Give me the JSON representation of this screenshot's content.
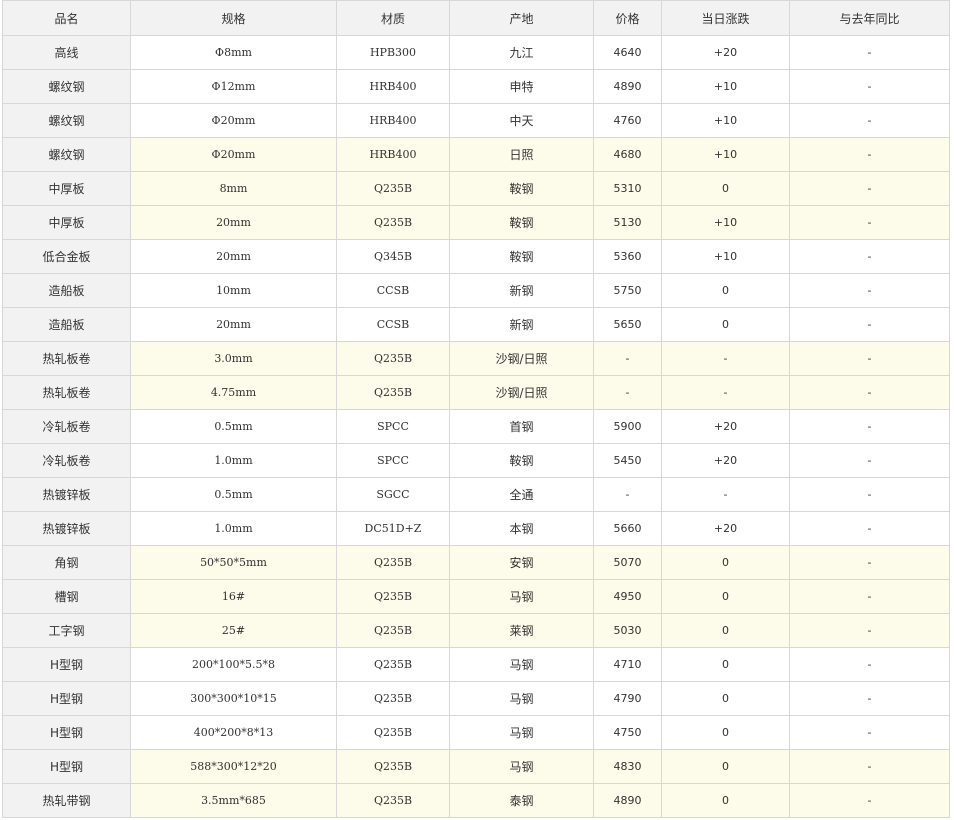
{
  "headers": [
    "品名",
    "规格",
    "材质",
    "产地",
    "价格",
    "当日涨跌",
    "与去年同比"
  ],
  "rows": [
    {
      "name": "高线",
      "spec": "Φ8mm",
      "material": "HPB300",
      "origin": "九江",
      "price": "4640",
      "change": "+20",
      "yoy": "-",
      "highlight": false
    },
    {
      "name": "螺纹钢",
      "spec": "Φ12mm",
      "material": "HRB400",
      "origin": "申特",
      "price": "4890",
      "change": "+10",
      "yoy": "-",
      "highlight": false
    },
    {
      "name": "螺纹钢",
      "spec": "Φ20mm",
      "material": "HRB400",
      "origin": "中天",
      "price": "4760",
      "change": "+10",
      "yoy": "-",
      "highlight": false
    },
    {
      "name": "螺纹钢",
      "spec": "Φ20mm",
      "material": "HRB400",
      "origin": "日照",
      "price": "4680",
      "change": "+10",
      "yoy": "-",
      "highlight": true
    },
    {
      "name": "中厚板",
      "spec": "8mm",
      "material": "Q235B",
      "origin": "鞍钢",
      "price": "5310",
      "change": "0",
      "yoy": "-",
      "highlight": true
    },
    {
      "name": "中厚板",
      "spec": "20mm",
      "material": "Q235B",
      "origin": "鞍钢",
      "price": "5130",
      "change": "+10",
      "yoy": "-",
      "highlight": true
    },
    {
      "name": "低合金板",
      "spec": "20mm",
      "material": "Q345B",
      "origin": "鞍钢",
      "price": "5360",
      "change": "+10",
      "yoy": "-",
      "highlight": false
    },
    {
      "name": "造船板",
      "spec": "10mm",
      "material": "CCSB",
      "origin": "新钢",
      "price": "5750",
      "change": "0",
      "yoy": "-",
      "highlight": false
    },
    {
      "name": "造船板",
      "spec": "20mm",
      "material": "CCSB",
      "origin": "新钢",
      "price": "5650",
      "change": "0",
      "yoy": "-",
      "highlight": false
    },
    {
      "name": "热轧板卷",
      "spec": "3.0mm",
      "material": "Q235B",
      "origin": "沙钢/日照",
      "price": "-",
      "change": "-",
      "yoy": "-",
      "highlight": true
    },
    {
      "name": "热轧板卷",
      "spec": "4.75mm",
      "material": "Q235B",
      "origin": "沙钢/日照",
      "price": "-",
      "change": "-",
      "yoy": "-",
      "highlight": true
    },
    {
      "name": "冷轧板卷",
      "spec": "0.5mm",
      "material": "SPCC",
      "origin": "首钢",
      "price": "5900",
      "change": "+20",
      "yoy": "-",
      "highlight": false
    },
    {
      "name": "冷轧板卷",
      "spec": "1.0mm",
      "material": "SPCC",
      "origin": "鞍钢",
      "price": "5450",
      "change": "+20",
      "yoy": "-",
      "highlight": false
    },
    {
      "name": "热镀锌板",
      "spec": "0.5mm",
      "material": "SGCC",
      "origin": "全通",
      "price": "-",
      "change": "-",
      "yoy": "-",
      "highlight": false
    },
    {
      "name": "热镀锌板",
      "spec": "1.0mm",
      "material": "DC51D+Z",
      "origin": "本钢",
      "price": "5660",
      "change": "+20",
      "yoy": "-",
      "highlight": false
    },
    {
      "name": "角钢",
      "spec": "50*50*5mm",
      "material": "Q235B",
      "origin": "安钢",
      "price": "5070",
      "change": "0",
      "yoy": "-",
      "highlight": true
    },
    {
      "name": "槽钢",
      "spec": "16#",
      "material": "Q235B",
      "origin": "马钢",
      "price": "4950",
      "change": "0",
      "yoy": "-",
      "highlight": true
    },
    {
      "name": "工字钢",
      "spec": "25#",
      "material": "Q235B",
      "origin": "莱钢",
      "price": "5030",
      "change": "0",
      "yoy": "-",
      "highlight": true
    },
    {
      "name": "H型钢",
      "spec": "200*100*5.5*8",
      "material": "Q235B",
      "origin": "马钢",
      "price": "4710",
      "change": "0",
      "yoy": "-",
      "highlight": false
    },
    {
      "name": "H型钢",
      "spec": "300*300*10*15",
      "material": "Q235B",
      "origin": "马钢",
      "price": "4790",
      "change": "0",
      "yoy": "-",
      "highlight": false
    },
    {
      "name": "H型钢",
      "spec": "400*200*8*13",
      "material": "Q235B",
      "origin": "马钢",
      "price": "4750",
      "change": "0",
      "yoy": "-",
      "highlight": false
    },
    {
      "name": "H型钢",
      "spec": "588*300*12*20",
      "material": "Q235B",
      "origin": "马钢",
      "price": "4830",
      "change": "0",
      "yoy": "-",
      "highlight": true
    },
    {
      "name": "热轧带钢",
      "spec": "3.5mm*685",
      "material": "Q235B",
      "origin": "泰钢",
      "price": "4890",
      "change": "0",
      "yoy": "-",
      "highlight": true
    }
  ]
}
